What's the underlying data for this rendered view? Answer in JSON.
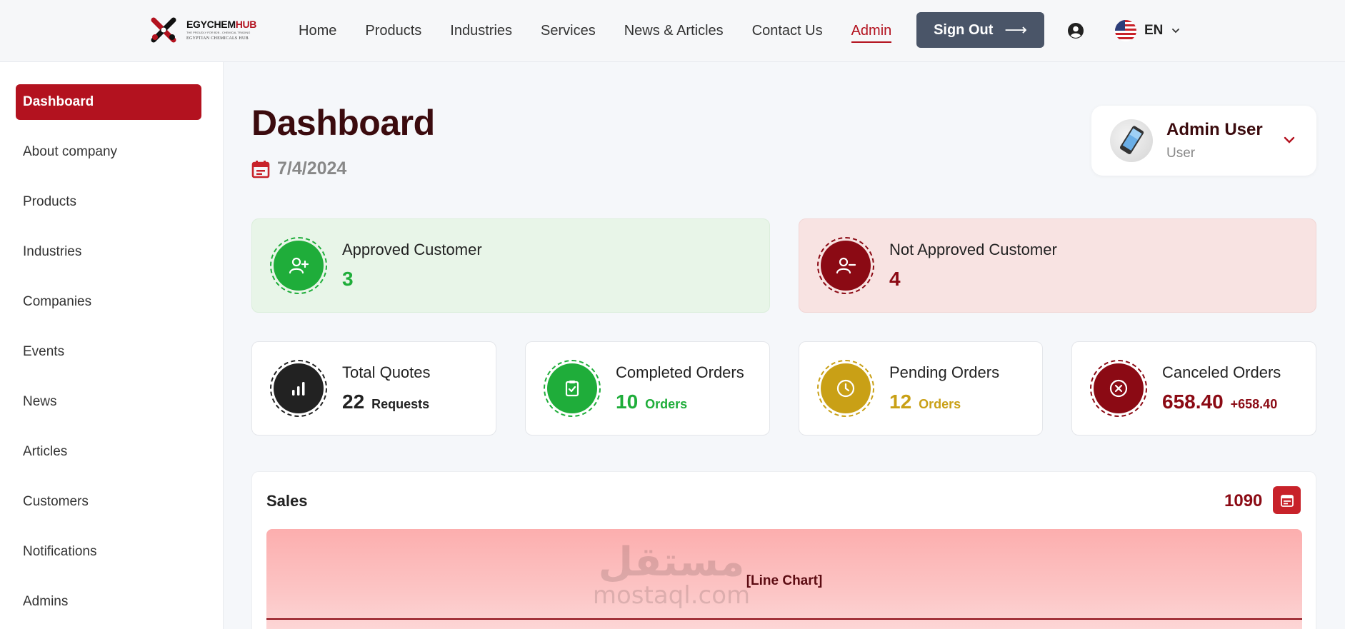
{
  "brand": {
    "name_dark": "EGYCHEM",
    "name_accent": "HUB",
    "tagline": "THE PROUDLY FOR B2B - CHEMICAL TRADING",
    "subtitle": "EGYPTIAN CHEMICALS HUB"
  },
  "nav": {
    "links": [
      "Home",
      "Products",
      "Industries",
      "Services",
      "News & Articles",
      "Contact Us",
      "Admin"
    ],
    "active": "Admin",
    "signout_label": "Sign Out",
    "signout_arrow": "⟶",
    "language": "EN"
  },
  "sidebar": {
    "items": [
      "Dashboard",
      "About company",
      "Products",
      "Industries",
      "Companies",
      "Events",
      "News",
      "Articles",
      "Customers",
      "Notifications",
      "Admins"
    ],
    "active": "Dashboard"
  },
  "header": {
    "title": "Dashboard",
    "date": "7/4/2024"
  },
  "profile": {
    "name": "Admin User",
    "role": "User"
  },
  "stats": {
    "approved": {
      "label": "Approved Customer",
      "value": "3",
      "color": "#1fad3a"
    },
    "not_approved": {
      "label": "Not Approved Customer",
      "value": "4",
      "color": "#8b0a14"
    },
    "quotes": {
      "label": "Total Quotes",
      "value": "22",
      "unit": "Requests",
      "color": "#222222"
    },
    "completed": {
      "label": "Completed Orders",
      "value": "10",
      "unit": "Orders",
      "color": "#1fad3a"
    },
    "pending": {
      "label": "Pending Orders",
      "value": "12",
      "unit": "Orders",
      "color": "#c9a016"
    },
    "canceled": {
      "label": "Canceled Orders",
      "value": "658.40",
      "unit": "+658.40",
      "color": "#8b0a14"
    }
  },
  "sales": {
    "title": "Sales",
    "total": "1090",
    "chart_placeholder": "[Line Chart]"
  },
  "watermark": {
    "arabic": "مستقل",
    "latin": "mostaql.com"
  },
  "colors": {
    "primary": "#b3121f",
    "nav_button": "#4a5568",
    "title_dark": "#3b0b0e"
  }
}
